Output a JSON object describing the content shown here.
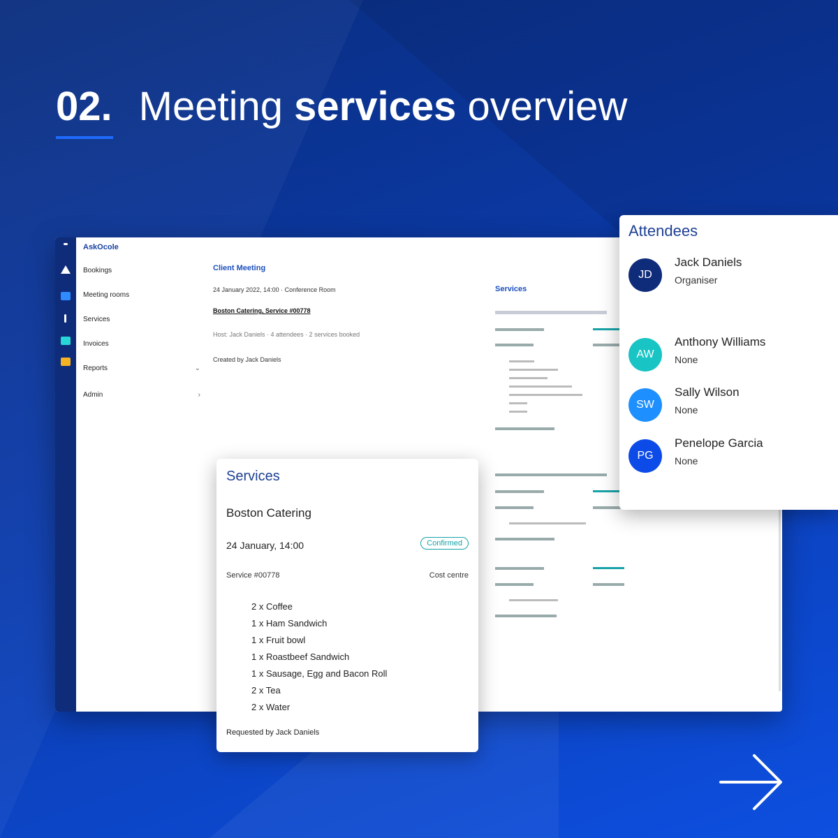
{
  "headline": {
    "number": "02.",
    "pre": "Meeting",
    "bold": "services",
    "post": "overview"
  },
  "app": {
    "brand": "AskOcole",
    "menu": [
      {
        "label": "Bookings",
        "chevron": ""
      },
      {
        "label": "Meeting rooms",
        "chevron": ""
      },
      {
        "label": "Services",
        "chevron": ""
      },
      {
        "label": "Invoices",
        "chevron": ""
      },
      {
        "label": "Reports",
        "chevron": "⌄"
      },
      {
        "label": "Admin",
        "chevron": "›"
      }
    ],
    "meeting_title": "Client Meeting",
    "meeting_lines": [
      "24 January 2022, 14:00  ·  Conference Room",
      "Boston Catering, Service #00778",
      "Host: Jack Daniels  ·  4 attendees  ·  2 services booked",
      "Created by Jack Daniels"
    ],
    "agenda_title": "Services",
    "colors": {
      "accent": "#1c4fbd",
      "teal": "#17a2a7",
      "rail": "#0f2c7a"
    }
  },
  "services": {
    "title": "Services",
    "vendor": "Boston Catering",
    "date": "24 January, 14:00",
    "status": "Confirmed",
    "reference": "Service #00778",
    "cost": "Cost centre",
    "items": [
      "2 x Coffee",
      "1 x Ham Sandwich",
      "1 x Fruit bowl",
      "1 x Roastbeef Sandwich",
      "1 x Sausage, Egg and Bacon Roll",
      "2 x Tea",
      "2 x Water"
    ],
    "footer": "Requested by Jack Daniels"
  },
  "attendees": {
    "title": "Attendees",
    "people": [
      {
        "initials": "JD",
        "name": "Jack Daniels",
        "role": "Organiser",
        "color": "#0f2c7a"
      },
      {
        "initials": "AW",
        "name": "Anthony Williams",
        "role": "None",
        "color": "#19c4c4"
      },
      {
        "initials": "SW",
        "name": "Sally Wilson",
        "role": "None",
        "color": "#1e8fff"
      },
      {
        "initials": "PG",
        "name": "Penelope Garcia",
        "role": "None",
        "color": "#0d4be8"
      }
    ]
  },
  "icons": [
    "arrow-right-icon",
    "calendar-icon",
    "chat-icon",
    "folder-icon",
    "logo-icon"
  ]
}
